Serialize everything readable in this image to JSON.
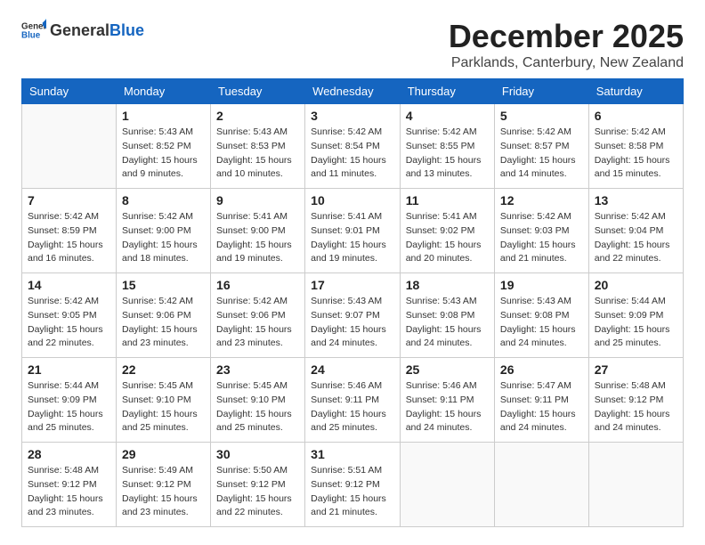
{
  "logo": {
    "general": "General",
    "blue": "Blue"
  },
  "title": "December 2025",
  "subtitle": "Parklands, Canterbury, New Zealand",
  "days_of_week": [
    "Sunday",
    "Monday",
    "Tuesday",
    "Wednesday",
    "Thursday",
    "Friday",
    "Saturday"
  ],
  "weeks": [
    [
      {
        "day": "",
        "info": ""
      },
      {
        "day": "1",
        "info": "Sunrise: 5:43 AM\nSunset: 8:52 PM\nDaylight: 15 hours\nand 9 minutes."
      },
      {
        "day": "2",
        "info": "Sunrise: 5:43 AM\nSunset: 8:53 PM\nDaylight: 15 hours\nand 10 minutes."
      },
      {
        "day": "3",
        "info": "Sunrise: 5:42 AM\nSunset: 8:54 PM\nDaylight: 15 hours\nand 11 minutes."
      },
      {
        "day": "4",
        "info": "Sunrise: 5:42 AM\nSunset: 8:55 PM\nDaylight: 15 hours\nand 13 minutes."
      },
      {
        "day": "5",
        "info": "Sunrise: 5:42 AM\nSunset: 8:57 PM\nDaylight: 15 hours\nand 14 minutes."
      },
      {
        "day": "6",
        "info": "Sunrise: 5:42 AM\nSunset: 8:58 PM\nDaylight: 15 hours\nand 15 minutes."
      }
    ],
    [
      {
        "day": "7",
        "info": "Sunrise: 5:42 AM\nSunset: 8:59 PM\nDaylight: 15 hours\nand 16 minutes."
      },
      {
        "day": "8",
        "info": "Sunrise: 5:42 AM\nSunset: 9:00 PM\nDaylight: 15 hours\nand 18 minutes."
      },
      {
        "day": "9",
        "info": "Sunrise: 5:41 AM\nSunset: 9:00 PM\nDaylight: 15 hours\nand 19 minutes."
      },
      {
        "day": "10",
        "info": "Sunrise: 5:41 AM\nSunset: 9:01 PM\nDaylight: 15 hours\nand 19 minutes."
      },
      {
        "day": "11",
        "info": "Sunrise: 5:41 AM\nSunset: 9:02 PM\nDaylight: 15 hours\nand 20 minutes."
      },
      {
        "day": "12",
        "info": "Sunrise: 5:42 AM\nSunset: 9:03 PM\nDaylight: 15 hours\nand 21 minutes."
      },
      {
        "day": "13",
        "info": "Sunrise: 5:42 AM\nSunset: 9:04 PM\nDaylight: 15 hours\nand 22 minutes."
      }
    ],
    [
      {
        "day": "14",
        "info": "Sunrise: 5:42 AM\nSunset: 9:05 PM\nDaylight: 15 hours\nand 22 minutes."
      },
      {
        "day": "15",
        "info": "Sunrise: 5:42 AM\nSunset: 9:06 PM\nDaylight: 15 hours\nand 23 minutes."
      },
      {
        "day": "16",
        "info": "Sunrise: 5:42 AM\nSunset: 9:06 PM\nDaylight: 15 hours\nand 23 minutes."
      },
      {
        "day": "17",
        "info": "Sunrise: 5:43 AM\nSunset: 9:07 PM\nDaylight: 15 hours\nand 24 minutes."
      },
      {
        "day": "18",
        "info": "Sunrise: 5:43 AM\nSunset: 9:08 PM\nDaylight: 15 hours\nand 24 minutes."
      },
      {
        "day": "19",
        "info": "Sunrise: 5:43 AM\nSunset: 9:08 PM\nDaylight: 15 hours\nand 24 minutes."
      },
      {
        "day": "20",
        "info": "Sunrise: 5:44 AM\nSunset: 9:09 PM\nDaylight: 15 hours\nand 25 minutes."
      }
    ],
    [
      {
        "day": "21",
        "info": "Sunrise: 5:44 AM\nSunset: 9:09 PM\nDaylight: 15 hours\nand 25 minutes."
      },
      {
        "day": "22",
        "info": "Sunrise: 5:45 AM\nSunset: 9:10 PM\nDaylight: 15 hours\nand 25 minutes."
      },
      {
        "day": "23",
        "info": "Sunrise: 5:45 AM\nSunset: 9:10 PM\nDaylight: 15 hours\nand 25 minutes."
      },
      {
        "day": "24",
        "info": "Sunrise: 5:46 AM\nSunset: 9:11 PM\nDaylight: 15 hours\nand 25 minutes."
      },
      {
        "day": "25",
        "info": "Sunrise: 5:46 AM\nSunset: 9:11 PM\nDaylight: 15 hours\nand 24 minutes."
      },
      {
        "day": "26",
        "info": "Sunrise: 5:47 AM\nSunset: 9:11 PM\nDaylight: 15 hours\nand 24 minutes."
      },
      {
        "day": "27",
        "info": "Sunrise: 5:48 AM\nSunset: 9:12 PM\nDaylight: 15 hours\nand 24 minutes."
      }
    ],
    [
      {
        "day": "28",
        "info": "Sunrise: 5:48 AM\nSunset: 9:12 PM\nDaylight: 15 hours\nand 23 minutes."
      },
      {
        "day": "29",
        "info": "Sunrise: 5:49 AM\nSunset: 9:12 PM\nDaylight: 15 hours\nand 23 minutes."
      },
      {
        "day": "30",
        "info": "Sunrise: 5:50 AM\nSunset: 9:12 PM\nDaylight: 15 hours\nand 22 minutes."
      },
      {
        "day": "31",
        "info": "Sunrise: 5:51 AM\nSunset: 9:12 PM\nDaylight: 15 hours\nand 21 minutes."
      },
      {
        "day": "",
        "info": ""
      },
      {
        "day": "",
        "info": ""
      },
      {
        "day": "",
        "info": ""
      }
    ]
  ]
}
